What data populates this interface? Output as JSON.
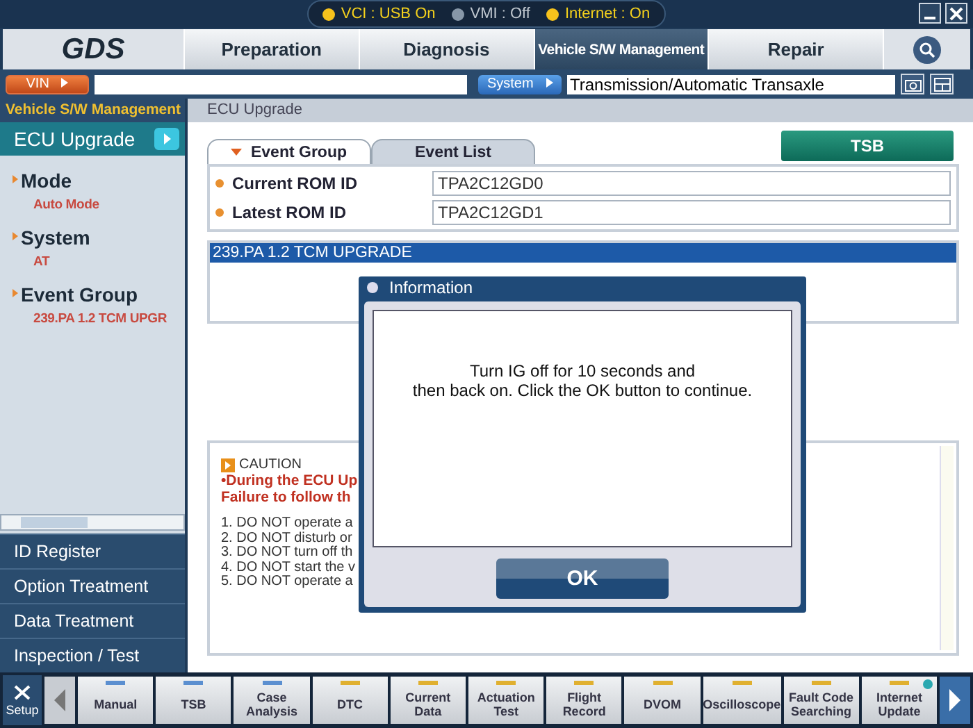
{
  "status": [
    {
      "label": "VCI : USB On",
      "on": true
    },
    {
      "label": "VMI : Off",
      "on": false
    },
    {
      "label": "Internet : On",
      "on": true
    }
  ],
  "logo": "GDS",
  "tabs": [
    {
      "label": "Preparation",
      "selected": false
    },
    {
      "label": "Diagnosis",
      "selected": false
    },
    {
      "label": "Vehicle S/W Management",
      "selected": true
    },
    {
      "label": "Repair",
      "selected": false
    }
  ],
  "vin": {
    "button": "VIN"
  },
  "system": {
    "button": "System",
    "value": "Transmission/Automatic Transaxle"
  },
  "sidebar": {
    "section": "Vehicle S/W Management",
    "current": "ECU Upgrade",
    "info": [
      {
        "label": "Mode",
        "value": "Auto Mode"
      },
      {
        "label": "System",
        "value": "AT"
      },
      {
        "label": "Event Group",
        "value": "239.PA 1.2 TCM UPGR"
      }
    ],
    "items": [
      "ID Register",
      "Option Treatment",
      "Data Treatment",
      "Inspection / Test"
    ]
  },
  "panel": {
    "title": "ECU Upgrade",
    "tabs": [
      {
        "label": "Event Group",
        "selected": true
      },
      {
        "label": "Event List",
        "selected": false
      }
    ],
    "tsb": "TSB",
    "fields": [
      {
        "label": "Current ROM ID",
        "value": "TPA2C12GD0"
      },
      {
        "label": "Latest ROM ID",
        "value": "TPA2C12GD1"
      }
    ],
    "events": [
      {
        "label": "239.PA 1.2 TCM UPGRADE",
        "selected": true
      }
    ],
    "caution": {
      "title": "CAUTION",
      "warnings": [
        "•During the ECU Up",
        "Failure to follow th"
      ],
      "lines": [
        "1. DO NOT operate a",
        "2. DO NOT disturb or",
        "3. DO NOT turn off th",
        "4. DO NOT start the v",
        "5. DO NOT operate a"
      ]
    }
  },
  "dialog": {
    "title": "Information",
    "message": [
      "Turn IG off for 10 seconds and",
      "then back on. Click the OK button to continue."
    ],
    "button": "OK"
  },
  "toolbar": {
    "setup": "Setup",
    "items": [
      {
        "label": "Manual",
        "color": "#5b8fd0"
      },
      {
        "label": "TSB",
        "color": "#5b8fd0"
      },
      {
        "label": "Case Analysis",
        "color": "#5b8fd0"
      },
      {
        "label": "DTC",
        "color": "#e0b030"
      },
      {
        "label": "Current Data",
        "color": "#e0b030"
      },
      {
        "label": "Actuation Test",
        "color": "#e0b030"
      },
      {
        "label": "Flight Record",
        "color": "#e0b030"
      },
      {
        "label": "DVOM",
        "color": "#e0b030"
      },
      {
        "label": "Oscilloscope",
        "color": "#e0b030"
      },
      {
        "label": "Fault Code Searching",
        "color": "#e0b030"
      },
      {
        "label": "Internet Update",
        "color": "#e0b030",
        "badge": true
      }
    ]
  }
}
